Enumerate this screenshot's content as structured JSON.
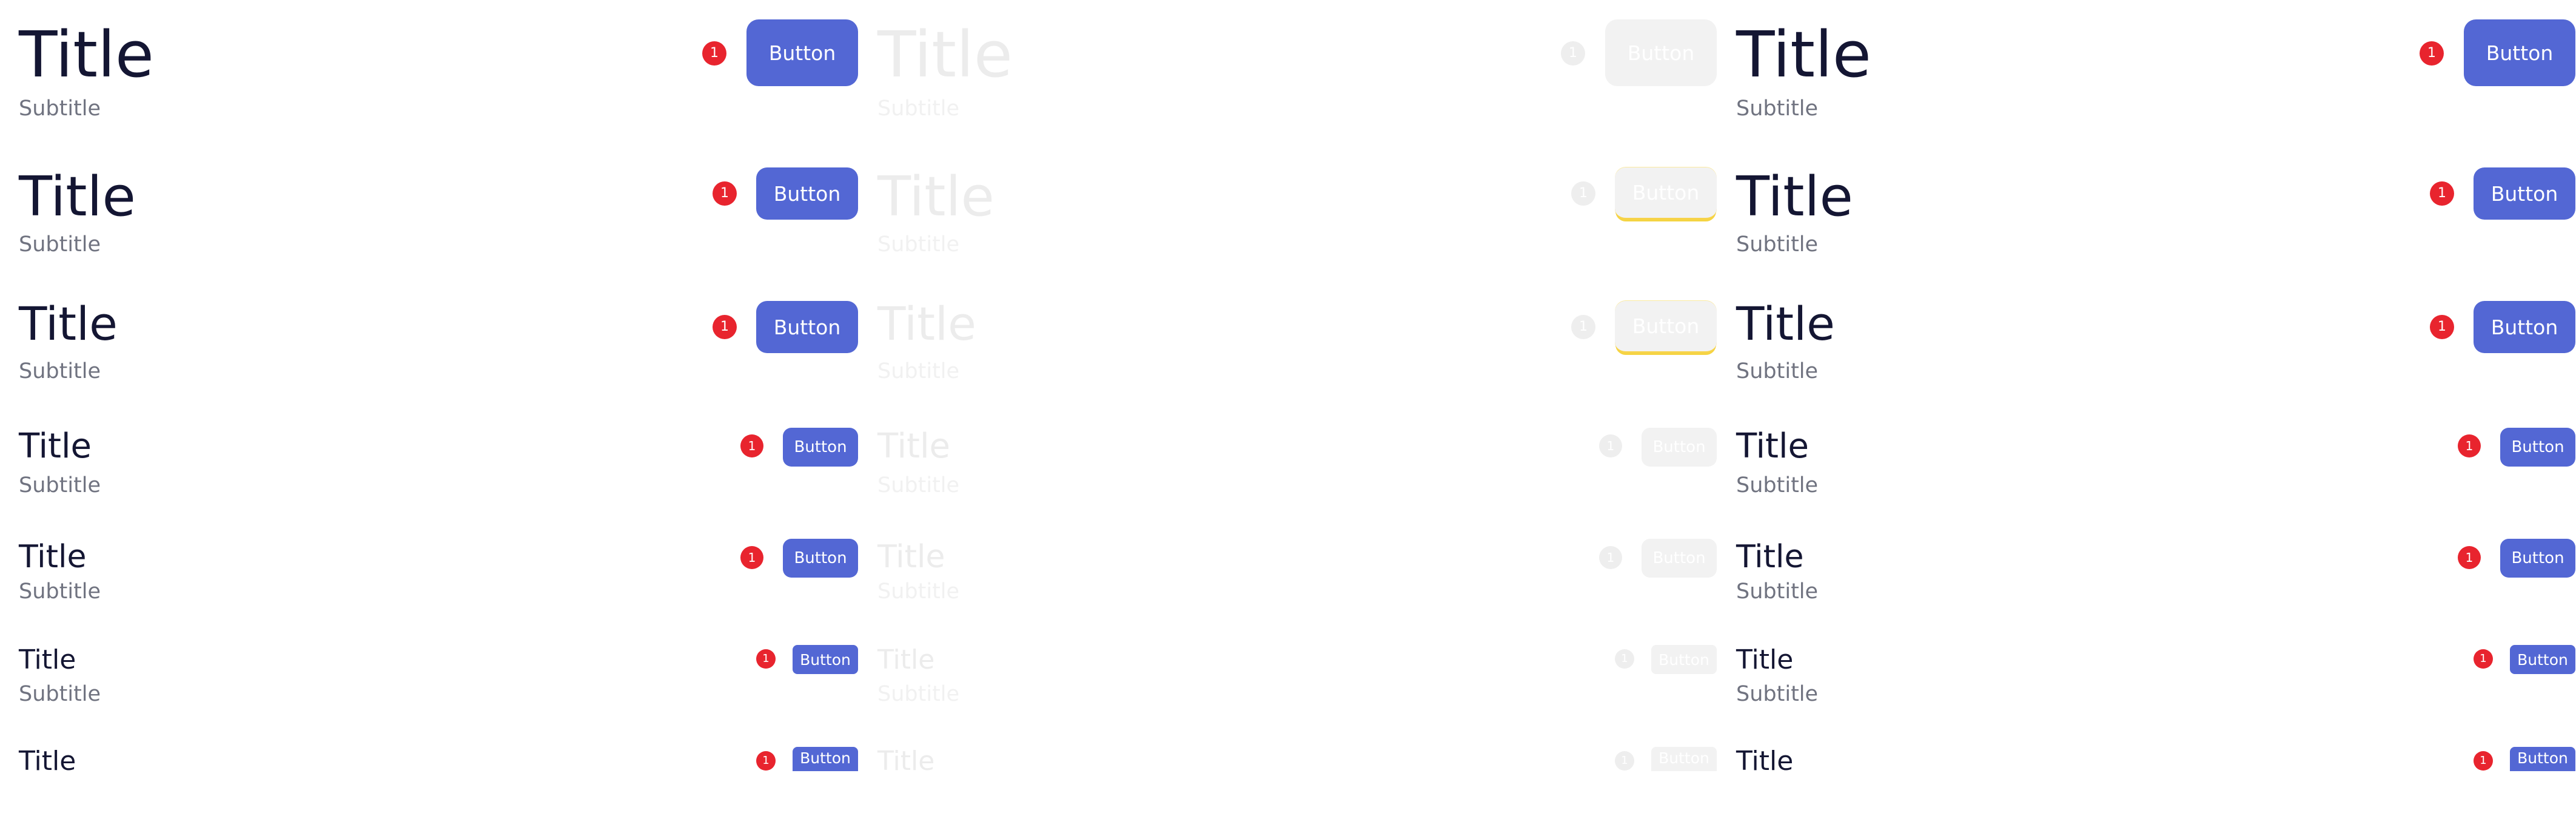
{
  "columns": [
    {
      "state": "default",
      "rows": [
        {
          "title": "Title",
          "subtitle": "Subtitle",
          "button": "Button",
          "badge": "1"
        },
        {
          "title": "Title",
          "subtitle": "Subtitle",
          "button": "Button",
          "badge": "1"
        },
        {
          "title": "Title",
          "subtitle": "Subtitle",
          "button": "Button",
          "badge": "1"
        },
        {
          "title": "Title",
          "subtitle": "Subtitle",
          "button": "Button",
          "badge": "1"
        },
        {
          "title": "Title",
          "subtitle": "Subtitle",
          "button": "Button",
          "badge": "1"
        },
        {
          "title": "Title",
          "subtitle": "Subtitle",
          "button": "Button",
          "badge": "1"
        },
        {
          "title": "Title",
          "button": "Button",
          "badge": "1"
        }
      ]
    },
    {
      "state": "disabled",
      "rows": [
        {
          "title": "Title",
          "subtitle": "Subtitle",
          "button": "Button",
          "badge": "1"
        },
        {
          "title": "Title",
          "subtitle": "Subtitle",
          "button": "Button",
          "badge": "1"
        },
        {
          "title": "Title",
          "subtitle": "Subtitle",
          "button": "Button",
          "badge": "1"
        },
        {
          "title": "Title",
          "subtitle": "Subtitle",
          "button": "Button",
          "badge": "1"
        },
        {
          "title": "Title",
          "subtitle": "Subtitle",
          "button": "Button",
          "badge": "1"
        },
        {
          "title": "Title",
          "subtitle": "Subtitle",
          "button": "Button",
          "badge": "1"
        },
        {
          "title": "Title",
          "button": "Button",
          "badge": "1"
        }
      ]
    },
    {
      "state": "default",
      "rows": [
        {
          "title": "Title",
          "subtitle": "Subtitle",
          "button": "Button",
          "badge": "1"
        },
        {
          "title": "Title",
          "subtitle": "Subtitle",
          "button": "Button",
          "badge": "1"
        },
        {
          "title": "Title",
          "subtitle": "Subtitle",
          "button": "Button",
          "badge": "1"
        },
        {
          "title": "Title",
          "subtitle": "Subtitle",
          "button": "Button",
          "badge": "1"
        },
        {
          "title": "Title",
          "subtitle": "Subtitle",
          "button": "Button",
          "badge": "1"
        },
        {
          "title": "Title",
          "subtitle": "Subtitle",
          "button": "Button",
          "badge": "1"
        },
        {
          "title": "Title",
          "button": "Button",
          "badge": "1"
        }
      ]
    }
  ],
  "colors": {
    "title": "#141633",
    "subtitle": "#707380",
    "button": "#5367d4",
    "badge": "#e8242e",
    "disabled_fill": "#f2f2f2",
    "focus_ring": "#f5d442"
  }
}
